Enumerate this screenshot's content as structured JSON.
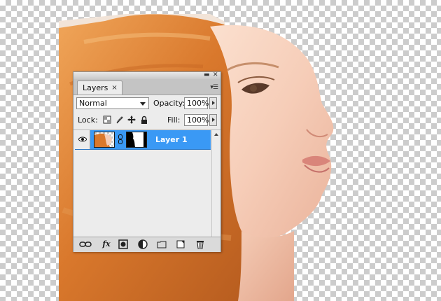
{
  "canvas": {
    "image": "portrait-photo-of-woman-with-auburn-hair-on-transparent-background",
    "transparent_pattern_colors": [
      "#ffffff",
      "#cccccc"
    ]
  },
  "layers_panel": {
    "titlebar": {
      "minimize_icon": "minimize-icon",
      "close_icon": "close-icon"
    },
    "tab": {
      "label": "Layers",
      "close_glyph": "×"
    },
    "panel_menu_icon": "panel-menu-icon",
    "blend_mode": {
      "value": "Normal"
    },
    "opacity": {
      "label": "Opacity:",
      "value": "100%"
    },
    "lock": {
      "label": "Lock:",
      "icons": [
        "lock-transparent-pixels-icon",
        "lock-image-pixels-icon",
        "lock-position-icon",
        "lock-all-icon"
      ]
    },
    "fill": {
      "label": "Fill:",
      "value": "100%"
    },
    "layers": [
      {
        "name": "Layer 1",
        "visible": true,
        "selected": true,
        "has_mask": true,
        "linked": true
      }
    ],
    "footer_buttons": [
      "link-layers-icon",
      "layer-style-fx-icon",
      "add-mask-icon",
      "adjustment-layer-icon",
      "new-group-icon",
      "new-layer-icon",
      "delete-layer-icon"
    ],
    "fx_label": "fx",
    "colors": {
      "selection": "#3a99f5",
      "panel_bg": "#ececec"
    }
  }
}
